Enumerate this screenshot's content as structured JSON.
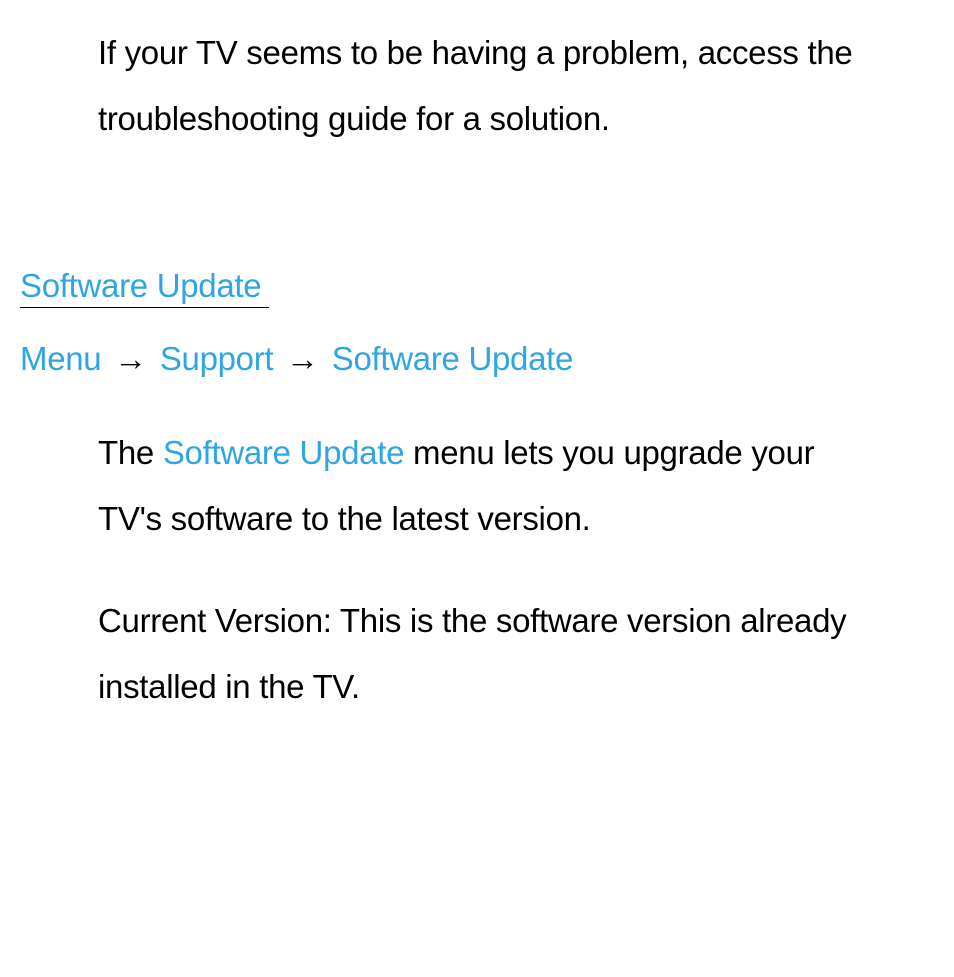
{
  "intro_text": "If your TV seems to be having a problem, access the troubleshooting guide for a solution.",
  "section_heading": "Software Update",
  "breadcrumb": {
    "item1": "Menu",
    "arrow": "→",
    "item2": "Support",
    "item3": "Software Update"
  },
  "paragraph1": {
    "prefix": "The ",
    "highlight": "Software Update",
    "suffix": " menu lets you upgrade your TV's software to the latest version."
  },
  "paragraph2": "Current Version: This is the software version already installed in the TV."
}
